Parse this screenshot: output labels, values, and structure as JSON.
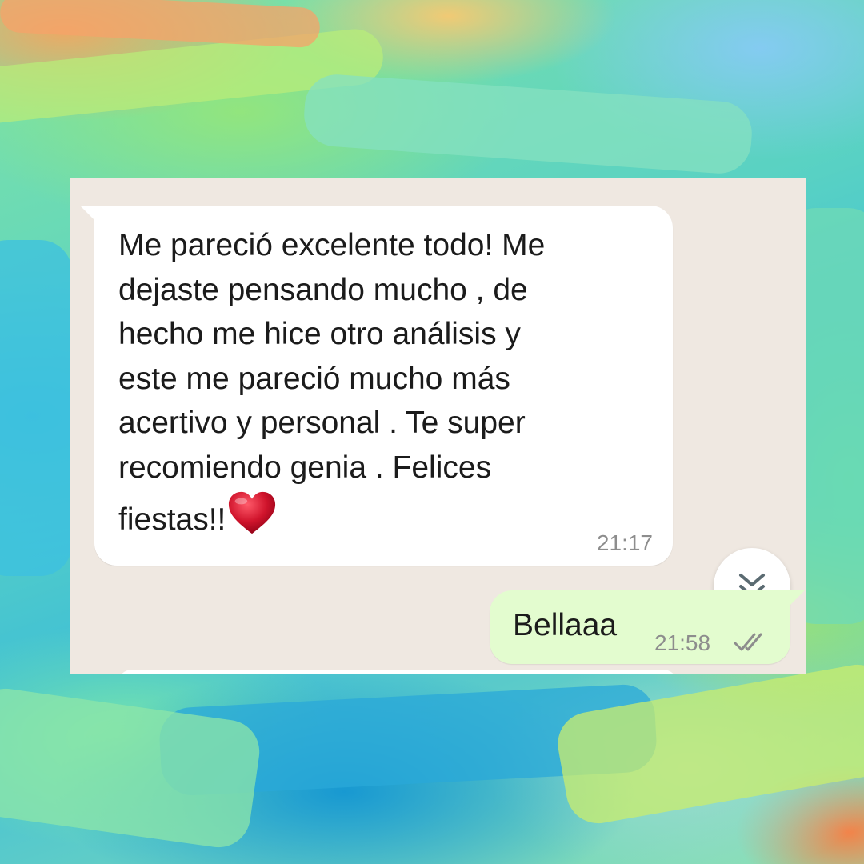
{
  "chat": {
    "incoming_message": {
      "lines": [
        "Me pareció excelente todo! Me",
        "dejaste pensando mucho , de",
        "hecho me hice otro análisis y",
        "este me pareció mucho más",
        "acertivo y personal . Te super",
        "recomiendo genia . Felices"
      ],
      "last_line": "fiestas!!",
      "emoji": "heart-icon",
      "time": "21:17"
    },
    "outgoing_message": {
      "text": "Bellaaa",
      "time": "21:58",
      "status_icon": "double-check-icon"
    },
    "scroll_button_icon": "chevron-double-down-icon"
  },
  "colors": {
    "panel_bg": "#efe8e1",
    "incoming_bubble": "#ffffff",
    "outgoing_bubble": "#e3fccf",
    "timestamp": "#8d8d8d",
    "heart": "#c8102e"
  }
}
